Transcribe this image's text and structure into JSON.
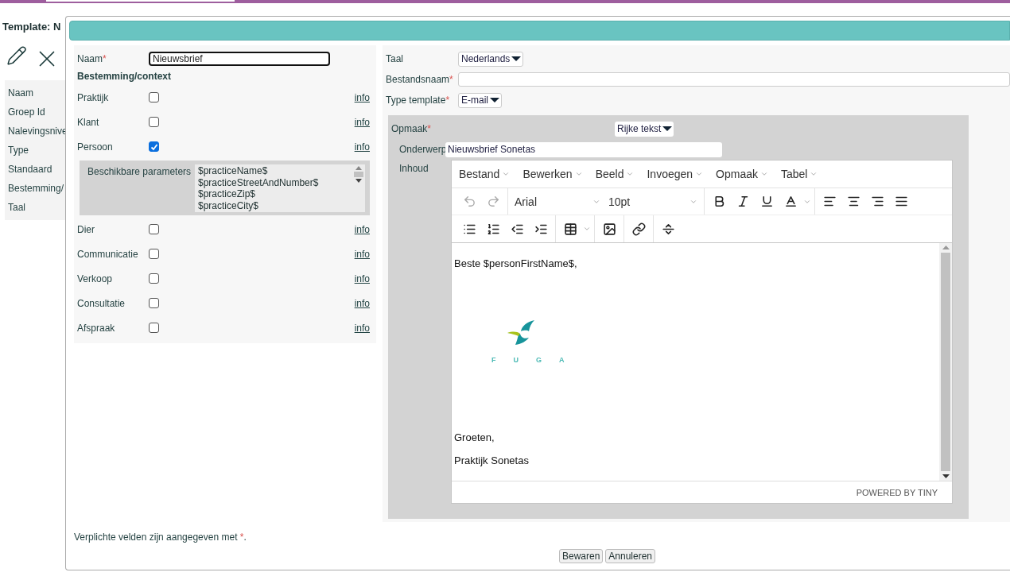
{
  "page": {
    "title": "Template: N",
    "fields": [
      "Naam",
      "Groep Id",
      "Nalevingsnive",
      "Type",
      "Standaard",
      "Bestemming/",
      "Taal"
    ]
  },
  "dialog": {
    "left": {
      "name": {
        "label": "Naam",
        "required": true,
        "value": "Nieuwsbrief"
      },
      "section": "Bestemming/context",
      "items": [
        {
          "kind": "checkbox",
          "label": "Praktijk",
          "checked": false,
          "link": "info"
        },
        {
          "kind": "checkbox",
          "label": "Klant",
          "checked": false,
          "link": "info"
        },
        {
          "kind": "checkbox",
          "label": "Persoon",
          "checked": true,
          "link": "info"
        },
        {
          "kind": "params",
          "label": "Beschikbare parameters",
          "lines": [
            "$practiceName$",
            "$practiceStreetAndNumber$",
            "$practiceZip$",
            "$practiceCity$"
          ]
        },
        {
          "kind": "checkbox",
          "label": "Dier",
          "checked": false,
          "link": "info"
        },
        {
          "kind": "checkbox",
          "label": "Communicatie",
          "checked": false,
          "link": "info"
        },
        {
          "kind": "checkbox",
          "label": "Verkoop",
          "checked": false,
          "link": "info"
        },
        {
          "kind": "checkbox",
          "label": "Consultatie",
          "checked": false,
          "link": "info"
        },
        {
          "kind": "checkbox",
          "label": "Afspraak",
          "checked": false,
          "link": "info"
        }
      ]
    },
    "right": {
      "fields": [
        {
          "kind": "select",
          "label": "Taal",
          "required": false,
          "value": "Nederlands"
        },
        {
          "kind": "text",
          "label": "Bestandsnaam",
          "required": true
        },
        {
          "kind": "select",
          "label": "Type template",
          "required": true,
          "value": "E-mail"
        }
      ],
      "format": {
        "label": "Opmaak",
        "required": true,
        "value": "Rijke tekst"
      },
      "subject": {
        "label": "Onderwerp",
        "value": "Nieuwsbrief Sonetas"
      },
      "content": {
        "label": "Inhoud",
        "menus": [
          "Bestand",
          "Bewerken",
          "Beeld",
          "Invoegen",
          "Opmaak",
          "Tabel"
        ],
        "font": "Arial",
        "size": "10pt",
        "body": [
          {
            "kind": "text",
            "text": "Beste $personFirstName$,"
          },
          {
            "kind": "logo",
            "text": "FUGA"
          },
          {
            "kind": "text",
            "text": "Groeten,"
          },
          {
            "kind": "text",
            "text": "Praktijk Sonetas"
          }
        ],
        "branding": "POWERED BY TINY"
      }
    },
    "note": {
      "text": "Verplichte velden zijn aangegeven met",
      "mark": "*",
      "end": "."
    },
    "buttons": [
      "Bewaren",
      "Annuleren"
    ]
  }
}
